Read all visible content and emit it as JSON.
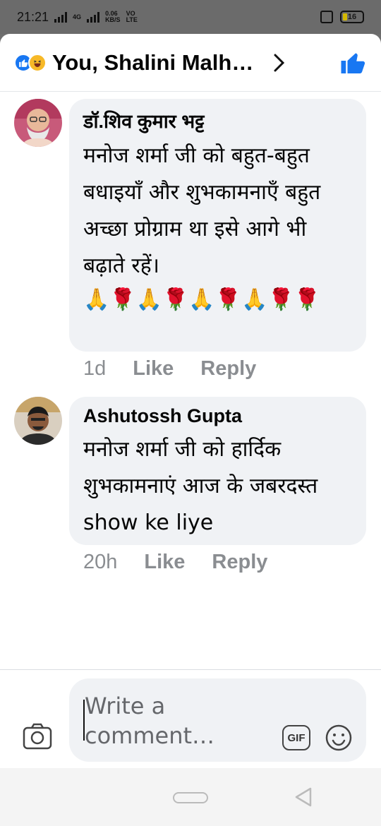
{
  "status_bar": {
    "time": "21:21",
    "net_1": "4G",
    "speed_value": "0.06",
    "speed_unit": "KB/S",
    "vo": "VO",
    "lte": "LTE",
    "battery": "16"
  },
  "header": {
    "title": "You, Shalini Malh…"
  },
  "comments": [
    {
      "name": "डॉ.शिव कुमार भट्ट",
      "text": "मनोज शर्मा जी को बहुत-बहुत बधाइयाँ और शुभकामनाएँ बहुत अच्छा प्रोग्राम था इसे आगे भी बढ़ाते रहें।",
      "emoji": "🙏🌹🙏🌹🙏🌹🙏🌹🌹",
      "time": "1d",
      "like": "Like",
      "reply": "Reply"
    },
    {
      "name": "Ashutossh Gupta",
      "text": "मनोज शर्मा जी को हार्दिक शुभकामनाएं आज के जबरदस्त show ke liye",
      "time": "20h",
      "like": "Like",
      "reply": "Reply"
    }
  ],
  "composer": {
    "placeholder": "Write a comment…",
    "gif": "GIF"
  },
  "colors": {
    "accent": "#1877f2",
    "bubble": "#f0f2f5",
    "meta": "#8a8d91"
  }
}
